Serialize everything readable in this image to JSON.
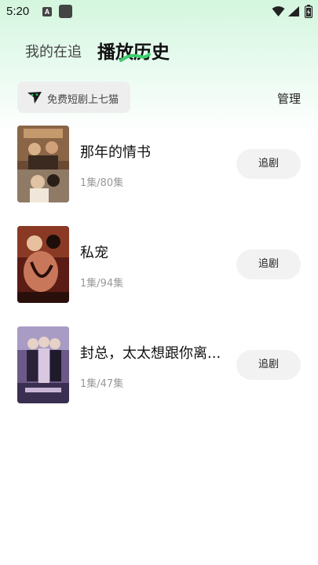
{
  "status_bar": {
    "time": "5:20",
    "notification_letter": "A"
  },
  "tabs": {
    "follow_label": "我的在追",
    "history_label": "播放历史",
    "active": "history_label"
  },
  "promo": {
    "text": "免费短剧上七猫"
  },
  "manage_label": "管理",
  "history": [
    {
      "title": "那年的情书",
      "progress": "1集/80集",
      "button_label": "追剧",
      "cover_colors": [
        "#6b4a33",
        "#c49a6c",
        "#3a2a20"
      ]
    },
    {
      "title": "私宠",
      "progress": "1集/94集",
      "button_label": "追剧",
      "cover_colors": [
        "#5a1c14",
        "#c9775a",
        "#2a0f0b"
      ]
    },
    {
      "title": "封总，太太想跟你离...",
      "progress": "1集/47集",
      "button_label": "追剧",
      "cover_colors": [
        "#6b5a88",
        "#c9b6d6",
        "#3a2f50"
      ]
    }
  ],
  "colors": {
    "accent_green": "#3ccf6e",
    "header_gradient": "#d4f6de",
    "button_bg": "#f2f2f2"
  }
}
